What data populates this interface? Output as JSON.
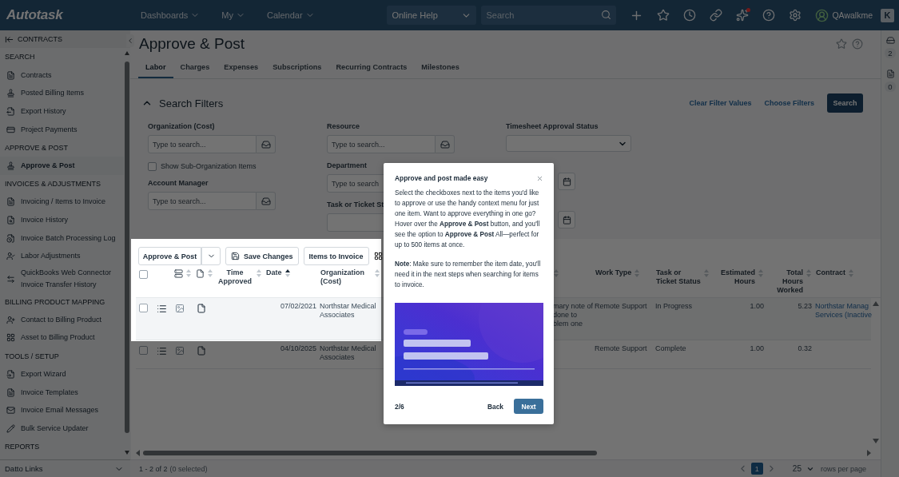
{
  "top_bar": {
    "logo": "Autotask",
    "nav": [
      "Dashboards",
      "My",
      "Calendar"
    ],
    "help_select": "Online Help",
    "search_placeholder": "Search",
    "user": "QAwalkme",
    "app_badge": "K"
  },
  "sidebar": {
    "header": "CONTRACTS",
    "sections": [
      {
        "title": "SEARCH",
        "items": [
          {
            "label": "Contracts",
            "selected": false
          },
          {
            "label": "Posted Billing Items",
            "selected": false
          },
          {
            "label": "Export History",
            "selected": false
          },
          {
            "label": "Project Payments",
            "selected": false
          }
        ]
      },
      {
        "title": "APPROVE & POST",
        "items": [
          {
            "label": "Approve & Post",
            "selected": true
          }
        ]
      },
      {
        "title": "INVOICES & ADJUSTMENTS",
        "items": [
          {
            "label": "Invoicing / Items to Invoice",
            "selected": false
          },
          {
            "label": "Invoice History",
            "selected": false
          },
          {
            "label": "Invoice Batch Processing Log",
            "selected": false
          },
          {
            "label": "Labor Adjustments",
            "selected": false
          },
          {
            "label": "QuickBooks Web Connector Invoice Transfer History",
            "selected": false
          }
        ]
      },
      {
        "title": "BILLING PRODUCT MAPPING",
        "items": [
          {
            "label": "Contact to Billing Product",
            "selected": false
          },
          {
            "label": "Asset to Billing Product",
            "selected": false
          }
        ]
      },
      {
        "title": "TOOLS / SETUP",
        "items": [
          {
            "label": "Export Wizard",
            "selected": false
          },
          {
            "label": "Invoice Templates",
            "selected": false
          },
          {
            "label": "Invoice Email Messages",
            "selected": false
          },
          {
            "label": "Bulk Service Updater",
            "selected": false
          }
        ]
      },
      {
        "title": "REPORTS"
      }
    ],
    "footer": "Datto Links"
  },
  "page": {
    "title": "Approve & Post"
  },
  "tabs": [
    {
      "label": "Labor",
      "selected": true
    },
    {
      "label": "Charges",
      "selected": false
    },
    {
      "label": "Expenses",
      "selected": false
    },
    {
      "label": "Subscriptions",
      "selected": false
    },
    {
      "label": "Recurring Contracts",
      "selected": false
    },
    {
      "label": "Milestones",
      "selected": false
    }
  ],
  "filters": {
    "title": "Search Filters",
    "expanded": true,
    "links": [
      "Clear Filter Values",
      "Choose Filters"
    ],
    "search_button": "Search",
    "columns": [
      {
        "fields": [
          {
            "kind": "lookup",
            "label": "Organization (Cost)",
            "placeholder": "Type to search..."
          },
          {
            "kind": "checkbox",
            "label": "Show Sub-Organization Items",
            "checked": false
          },
          {
            "kind": "lookup",
            "label": "Account Manager",
            "placeholder": "Type to search..."
          }
        ]
      },
      {
        "fields": [
          {
            "kind": "lookup",
            "label": "Resource",
            "placeholder": "Type to search..."
          },
          {
            "kind": "text",
            "label": "Department",
            "placeholder": "Type to search"
          },
          {
            "kind": "text",
            "label": "Task or Ticket St"
          }
        ]
      },
      {
        "fields": [
          {
            "kind": "select",
            "label": "Timesheet Approval Status"
          },
          {
            "kind": "date"
          },
          {
            "kind": "date"
          }
        ]
      }
    ]
  },
  "toolbar": {
    "approve_button": "Approve & Post",
    "buttons": [
      {
        "kind": "save",
        "label": "Save Changes"
      },
      {
        "kind": "plain",
        "label": "Items to Invoice"
      }
    ]
  },
  "table": {
    "select_all": {
      "checked": false
    },
    "columns": [
      {
        "kind": "menu"
      },
      {
        "kind": "server",
        "sorted": false
      },
      {
        "kind": "document",
        "sorted": false
      },
      {
        "kind": "text",
        "label": "Time Approved",
        "sorted": false
      },
      {
        "kind": "text",
        "label": "Date",
        "sorted": true
      },
      {
        "kind": "text",
        "label": "Organization (Cost)",
        "sorted": false
      },
      {
        "kind": "hidden"
      },
      {
        "kind": "text",
        "sorted": false
      },
      {
        "kind": "text",
        "label": "Work Type",
        "sorted": false
      },
      {
        "kind": "text",
        "label": "Task or Ticket Status",
        "sorted": false
      },
      {
        "kind": "number",
        "label": "Estimated Hours",
        "sorted": false
      },
      {
        "kind": "number",
        "label": "Total Hours Worked",
        "sorted": false
      },
      {
        "kind": "link",
        "label": "Contract",
        "sorted": false
      }
    ],
    "rows": [
      {
        "checked": false,
        "cells": [
          null,
          null,
          null,
          null,
          "07/02/2021",
          "Northstar Medical\nAssociates",
          null,
          "mary note of\ndone to\nblem one",
          "Remote Support",
          "In Progress",
          "1.00",
          "5.23",
          "Northstar Manag\nServices (Inactive"
        ]
      },
      {
        "checked": false,
        "cells": [
          null,
          null,
          null,
          null,
          "04/10/2025",
          "Northstar Medical\nAssociates",
          null,
          null,
          "Remote Support",
          "Complete",
          "1.00",
          "0.32",
          null
        ]
      }
    ]
  },
  "footer": {
    "summary": "1 - 2 of 2",
    "selection": "(0 selected)",
    "pages": [
      {
        "label": "1",
        "selected": true
      }
    ],
    "page_size": "25",
    "page_size_label": "rows per page"
  },
  "rail": {
    "counts": [
      "2",
      "0"
    ]
  },
  "tour": {
    "title": "Approve and post made easy",
    "paragraphs": [
      "Select the checkboxes next to the items you'd like to approve or use the handy context menu for just one item. Want to approve everything in one go? Hover over the **Approve & Post** button, and you'll see the option to **Approve & Post** All—perfect for up to 500 items at once.",
      "**Note**: Make sure to remember the item date, you'll need it in the next steps when searching for items to invoice."
    ],
    "video": {
      "kind": "picture"
    },
    "step": "2/6",
    "back": "Back",
    "next": "Next"
  }
}
